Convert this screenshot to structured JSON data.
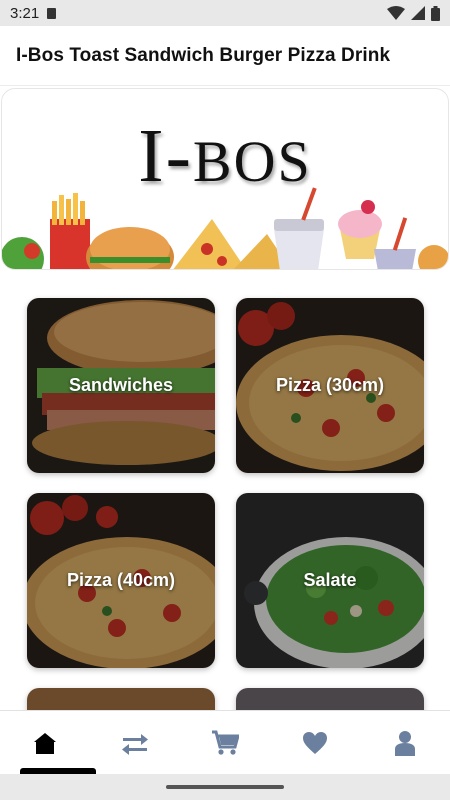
{
  "status_bar": {
    "time": "3:21"
  },
  "app_bar": {
    "title": "I-Bos Toast Sandwich Burger Pizza Drink"
  },
  "banner": {
    "brand_big": "I-",
    "brand_small": "BOS"
  },
  "categories": [
    {
      "label": "Sandwiches"
    },
    {
      "label": "Pizza (30cm)"
    },
    {
      "label": "Pizza (40cm)"
    },
    {
      "label": "Salate"
    }
  ],
  "bottom_nav": {
    "items": [
      "home-icon",
      "swap-icon",
      "cart-icon",
      "heart-icon",
      "profile-icon"
    ],
    "active_color": "#000000",
    "inactive_color": "#6b7f9e"
  }
}
